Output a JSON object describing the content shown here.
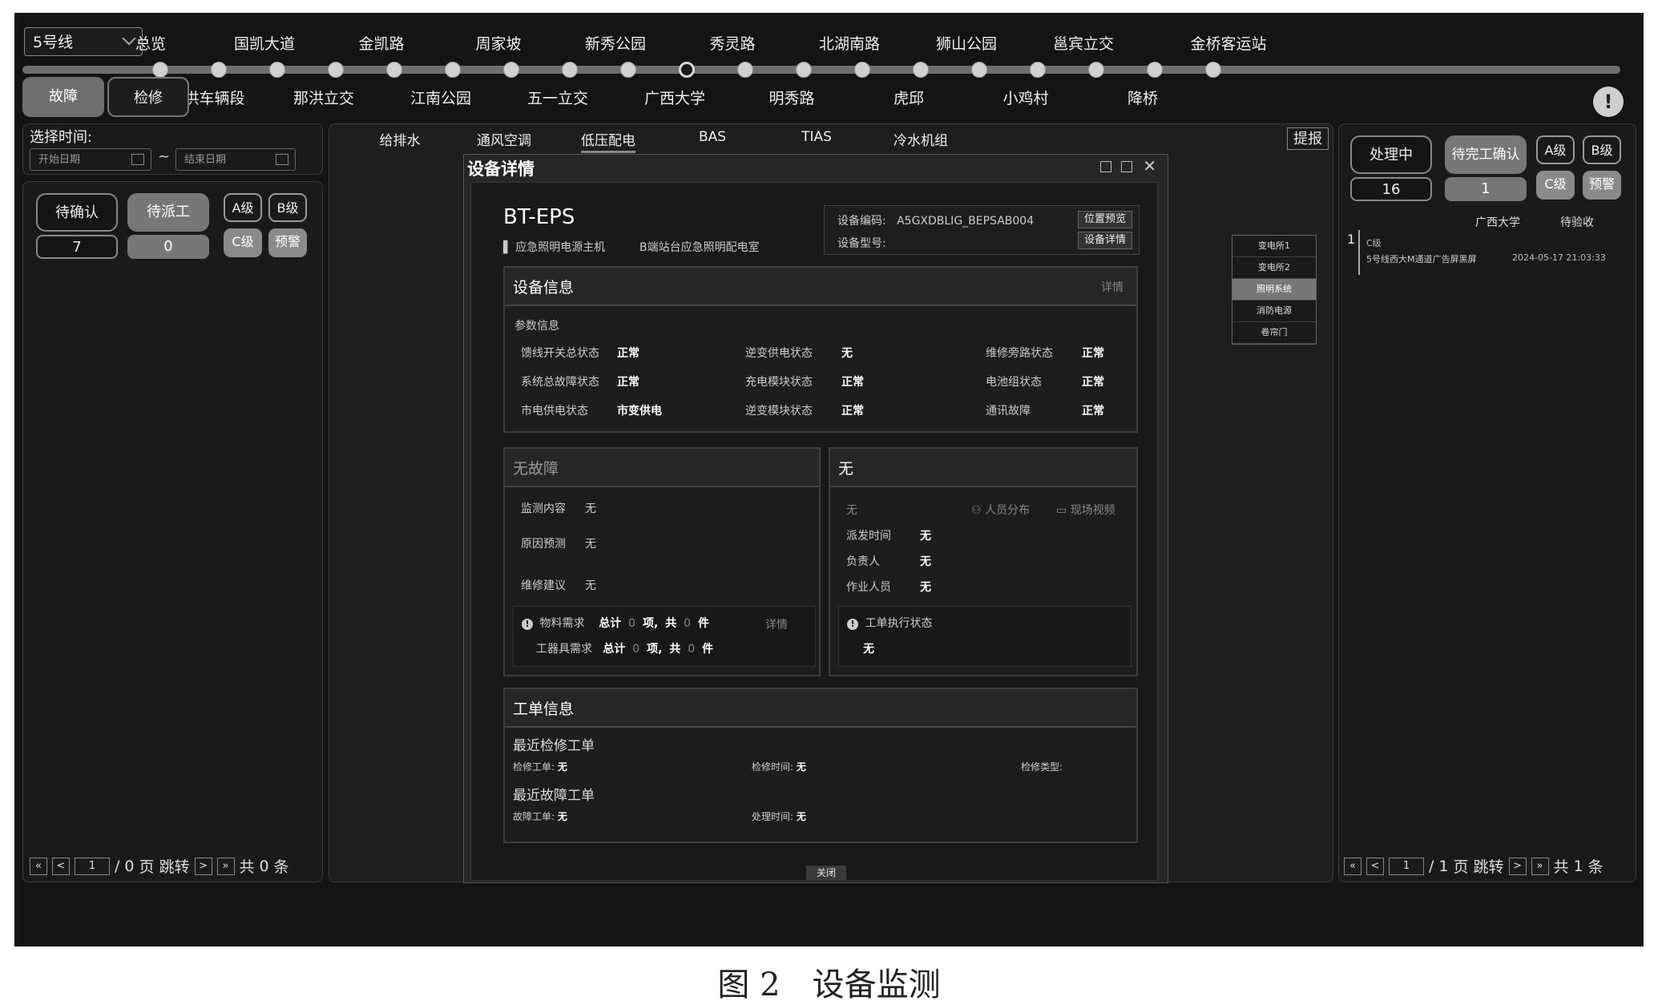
{
  "line_select": {
    "value": "5号线"
  },
  "top_stations": [
    "总览",
    "国凯大道",
    "金凯路",
    "周家坡",
    "新秀公园",
    "秀灵路",
    "北湖南路",
    "狮山公园",
    "邕宾立交",
    "金桥客运站"
  ],
  "bottom_stations": [
    "那洪车辆段",
    "那洪立交",
    "江南公园",
    "五一立交",
    "广西大学",
    "明秀路",
    "虎邱",
    "小鸡村",
    "降桥"
  ],
  "mode_buttons": {
    "fault": "故障",
    "repair": "检修"
  },
  "alert_icon": "!",
  "time_filter": {
    "title": "选择时间:",
    "start_placeholder": "开始日期",
    "end_placeholder": "结束日期",
    "separator": "~"
  },
  "left_panel": {
    "pending_confirm": {
      "label": "待确认",
      "count": "7"
    },
    "pending_dispatch": {
      "label": "待派工",
      "count": "0"
    },
    "levels": [
      "A级",
      "B级",
      "C级",
      "预警"
    ],
    "pager": {
      "first": "«",
      "prev": "<",
      "page": "1",
      "sep": "/",
      "total_pages": "0",
      "page_word": "页",
      "jump": "跳转",
      "next": ">",
      "last": "»",
      "total_prefix": "共",
      "total_count": "0",
      "unit": "条"
    }
  },
  "tabs": [
    "给排水",
    "通风空调",
    "低压配电",
    "BAS",
    "TIAS",
    "冷水机组"
  ],
  "report_button": "提报",
  "side_list": [
    "变电所1",
    "变电所2",
    "照明系统",
    "消防电源",
    "卷帘门"
  ],
  "modal": {
    "title": "设备详情",
    "device_name": "BT-EPS",
    "device_type": "应急照明电源主机",
    "device_location": "B端站台应急照明配电室",
    "code_label": "设备编码:",
    "code_value": "A5GXDBLIG_BEPSAB004",
    "model_label": "设备型号:",
    "position_preview": "位置预览",
    "device_detail": "设备详情",
    "info_card": {
      "title": "设备信息",
      "detail": "详情",
      "section": "参数信息",
      "params": [
        {
          "label": "馈线开关总状态",
          "value": "正常"
        },
        {
          "label": "逆变供电状态",
          "value": "无"
        },
        {
          "label": "维修旁路状态",
          "value": "正常"
        },
        {
          "label": "系统总故障状态",
          "value": "正常"
        },
        {
          "label": "充电模块状态",
          "value": "正常"
        },
        {
          "label": "电池组状态",
          "value": "正常"
        },
        {
          "label": "市电供电状态",
          "value": "市变供电"
        },
        {
          "label": "逆变模块状态",
          "value": "正常"
        },
        {
          "label": "通讯故障",
          "value": "正常"
        }
      ]
    },
    "fault_card": {
      "title": "无故障",
      "monitor_label": "监测内容",
      "monitor_value": "无",
      "cause_label": "原因预测",
      "cause_value": "无",
      "advice_label": "维修建议",
      "advice_value": "无",
      "material_label": "物料需求",
      "tool_label": "工器具需求",
      "total_word": "总计",
      "zero": "0",
      "item_word": "项,",
      "gong": "共",
      "piece": "件",
      "detail": "详情"
    },
    "dispatch_card": {
      "title": "无",
      "status": "无",
      "staff_dist": "人员分布",
      "live_video": "现场视频",
      "dispatch_time_label": "派发时间",
      "dispatch_time_value": "无",
      "owner_label": "负责人",
      "owner_value": "无",
      "worker_label": "作业人员",
      "worker_value": "无",
      "exec_label": "工单执行状态",
      "exec_value": "无"
    },
    "order_card": {
      "title": "工单信息",
      "recent_repair": "最近检修工单",
      "repair_order_label": "检修工单:",
      "repair_order_value": "无",
      "repair_time_label": "检修时间:",
      "repair_time_value": "无",
      "repair_type_label": "检修类型:",
      "recent_fault": "最近故障工单",
      "fault_order_label": "故障工单:",
      "fault_order_value": "无",
      "handle_time_label": "处理时间:",
      "handle_time_value": "无"
    },
    "close": "关闭"
  },
  "right_panel": {
    "processing": {
      "label": "处理中",
      "count": "16"
    },
    "pending_finish": {
      "label": "待完工确认",
      "count": "1"
    },
    "levels": [
      "A级",
      "B级",
      "C级",
      "预警"
    ],
    "col_station": "广西大学",
    "col_status": "待验收",
    "item": {
      "index": "1",
      "level": "C级",
      "desc": "5号线西大M通道广告屏黑屏",
      "time": "2024-05-17 21:03:33"
    },
    "pager": {
      "first": "«",
      "prev": "<",
      "page": "1",
      "sep": "/",
      "total_pages": "1",
      "page_word": "页",
      "jump": "跳转",
      "next": ">",
      "last": "»",
      "total_prefix": "共",
      "total_count": "1",
      "unit": "条"
    }
  },
  "caption": "图 2　设备监测"
}
